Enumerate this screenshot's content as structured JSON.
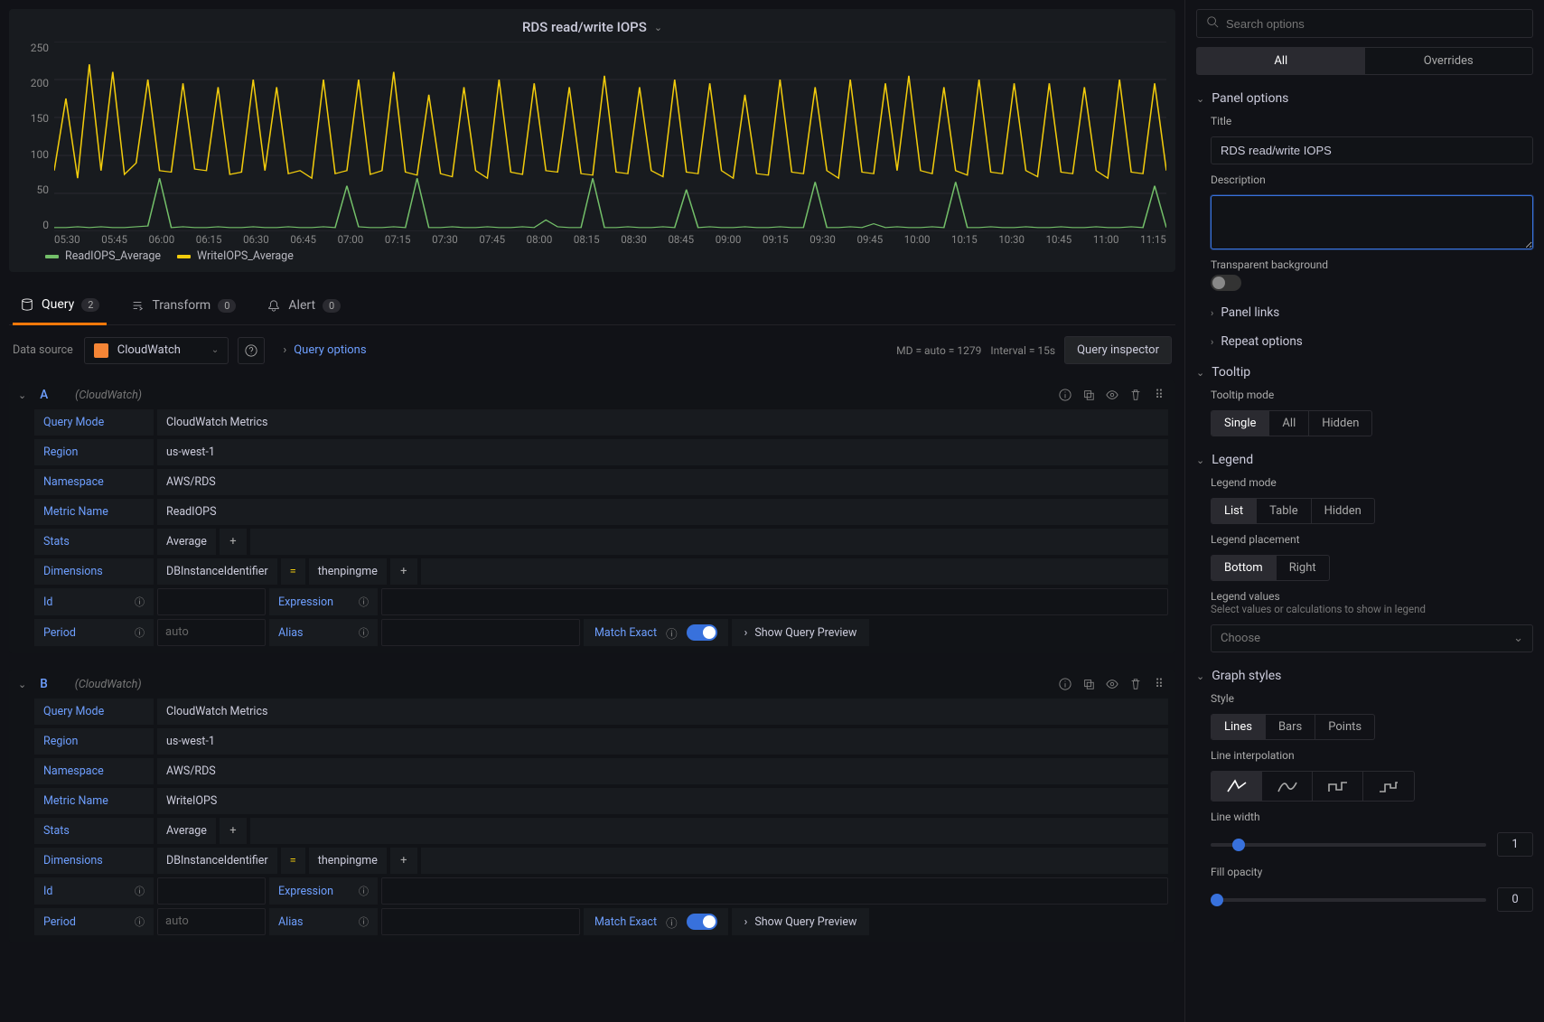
{
  "panel": {
    "title": "RDS read/write IOPS"
  },
  "chart_data": {
    "type": "line",
    "ylim": [
      0,
      250
    ],
    "y_ticks": [
      250,
      200,
      150,
      100,
      50,
      0
    ],
    "x_ticks": [
      "05:30",
      "05:45",
      "06:00",
      "06:15",
      "06:30",
      "06:45",
      "07:00",
      "07:15",
      "07:30",
      "07:45",
      "08:00",
      "08:15",
      "08:30",
      "08:45",
      "09:00",
      "09:15",
      "09:30",
      "09:45",
      "10:00",
      "10:15",
      "10:30",
      "10:45",
      "11:00",
      "11:15"
    ],
    "series": [
      {
        "name": "ReadIOPS_Average",
        "color": "#73bf69",
        "values": [
          5,
          5,
          6,
          5,
          6,
          5,
          5,
          6,
          7,
          70,
          5,
          6,
          5,
          5,
          6,
          5,
          5,
          6,
          5,
          5,
          6,
          5,
          5,
          6,
          5,
          60,
          6,
          5,
          5,
          6,
          5,
          70,
          5,
          5,
          6,
          5,
          5,
          6,
          5,
          5,
          6,
          5,
          15,
          6,
          5,
          5,
          70,
          5,
          5,
          6,
          5,
          5,
          6,
          5,
          55,
          5,
          6,
          5,
          5,
          6,
          5,
          5,
          6,
          5,
          5,
          65,
          5,
          5,
          6,
          5,
          10,
          5,
          6,
          5,
          5,
          6,
          5,
          65,
          5,
          5,
          6,
          5,
          5,
          6,
          5,
          5,
          6,
          5,
          5,
          6,
          5,
          5,
          6,
          5,
          60,
          5
        ]
      },
      {
        "name": "WriteIOPS_Average",
        "color": "#f2cc0c",
        "values": [
          80,
          175,
          70,
          220,
          80,
          210,
          75,
          90,
          200,
          80,
          78,
          195,
          82,
          80,
          190,
          75,
          78,
          200,
          80,
          190,
          76,
          80,
          70,
          200,
          76,
          80,
          200,
          75,
          80,
          210,
          78,
          74,
          180,
          76,
          72,
          190,
          80,
          70,
          200,
          78,
          75,
          195,
          80,
          78,
          190,
          76,
          74,
          205,
          78,
          76,
          190,
          80,
          72,
          200,
          78,
          76,
          195,
          80,
          70,
          180,
          76,
          74,
          200,
          78,
          76,
          190,
          80,
          70,
          200,
          78,
          76,
          195,
          80,
          205,
          80,
          76,
          190,
          80,
          74,
          200,
          78,
          76,
          195,
          80,
          72,
          195,
          78,
          76,
          190,
          80,
          70,
          200,
          78,
          76,
          195,
          80
        ]
      }
    ]
  },
  "legend": {
    "items": [
      {
        "label": "ReadIOPS_Average",
        "color": "#73bf69"
      },
      {
        "label": "WriteIOPS_Average",
        "color": "#f2cc0c"
      }
    ]
  },
  "tabs": {
    "query": {
      "label": "Query",
      "count": "2"
    },
    "transform": {
      "label": "Transform",
      "count": "0"
    },
    "alert": {
      "label": "Alert",
      "count": "0"
    }
  },
  "datasource": {
    "label": "Data source",
    "name": "CloudWatch",
    "query_options": "Query options",
    "meta_md": "MD = auto = 1279",
    "meta_interval": "Interval = 15s",
    "inspector": "Query inspector"
  },
  "queries": [
    {
      "ref": "A",
      "ds_hint": "(CloudWatch)",
      "mode_key": "Query Mode",
      "mode_val": "CloudWatch Metrics",
      "region_key": "Region",
      "region_val": "us-west-1",
      "ns_key": "Namespace",
      "ns_val": "AWS/RDS",
      "metric_key": "Metric Name",
      "metric_val": "ReadIOPS",
      "stats_key": "Stats",
      "stats_val": "Average",
      "dim_key": "Dimensions",
      "dim_name": "DBInstanceIdentifier",
      "dim_val": "thenpingme",
      "id_key": "Id",
      "expr_key": "Expression",
      "period_key": "Period",
      "period_val": "auto",
      "alias_key": "Alias",
      "match_exact": "Match Exact",
      "show_preview": "Show Query Preview"
    },
    {
      "ref": "B",
      "ds_hint": "(CloudWatch)",
      "mode_key": "Query Mode",
      "mode_val": "CloudWatch Metrics",
      "region_key": "Region",
      "region_val": "us-west-1",
      "ns_key": "Namespace",
      "ns_val": "AWS/RDS",
      "metric_key": "Metric Name",
      "metric_val": "WriteIOPS",
      "stats_key": "Stats",
      "stats_val": "Average",
      "dim_key": "Dimensions",
      "dim_name": "DBInstanceIdentifier",
      "dim_val": "thenpingme",
      "id_key": "Id",
      "expr_key": "Expression",
      "period_key": "Period",
      "period_val": "auto",
      "alias_key": "Alias",
      "match_exact": "Match Exact",
      "show_preview": "Show Query Preview"
    }
  ],
  "sidebar": {
    "search_placeholder": "Search options",
    "seg_all": "All",
    "seg_overrides": "Overrides",
    "panel_options": {
      "title": "Panel options",
      "title_label": "Title",
      "title_value": "RDS read/write IOPS",
      "desc_label": "Description",
      "transparent_label": "Transparent background",
      "links": "Panel links",
      "repeat": "Repeat options"
    },
    "tooltip": {
      "title": "Tooltip",
      "mode_label": "Tooltip mode",
      "opts": [
        "Single",
        "All",
        "Hidden"
      ]
    },
    "legend": {
      "title": "Legend",
      "mode_label": "Legend mode",
      "mode_opts": [
        "List",
        "Table",
        "Hidden"
      ],
      "placement_label": "Legend placement",
      "placement_opts": [
        "Bottom",
        "Right"
      ],
      "values_label": "Legend values",
      "values_hint": "Select values or calculations to show in legend",
      "values_placeholder": "Choose"
    },
    "graph_styles": {
      "title": "Graph styles",
      "style_label": "Style",
      "style_opts": [
        "Lines",
        "Bars",
        "Points"
      ],
      "interp_label": "Line interpolation",
      "width_label": "Line width",
      "width_val": "1",
      "opacity_label": "Fill opacity",
      "opacity_val": "0"
    }
  }
}
